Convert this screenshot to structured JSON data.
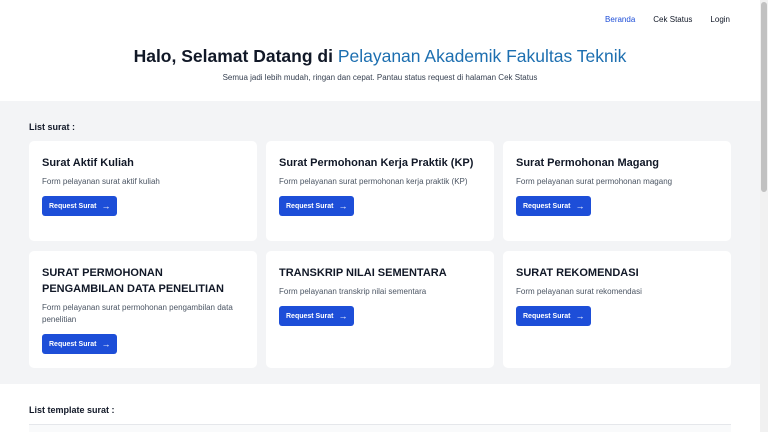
{
  "nav": {
    "items": [
      {
        "label": "Beranda",
        "active": true
      },
      {
        "label": "Cek Status",
        "active": false
      },
      {
        "label": "Login",
        "active": false
      }
    ]
  },
  "hero": {
    "title_prefix": "Halo, Selamat Datang di",
    "title_accent": "Pelayanan Akademik Fakultas Teknik",
    "subtitle": "Semua jadi lebih mudah, ringan dan cepat. Pantau status request di halaman Cek Status"
  },
  "list_surat": {
    "label": "List surat :",
    "button_label": "Request Surat",
    "cards": [
      {
        "title": "Surat Aktif Kuliah",
        "desc": "Form pelayanan surat aktif kuliah"
      },
      {
        "title": "Surat Permohonan Kerja Praktik (KP)",
        "desc": "Form pelayanan surat permohonan kerja praktik (KP)"
      },
      {
        "title": "Surat Permohonan Magang",
        "desc": "Form pelayanan surat permohonan magang"
      },
      {
        "title": "SURAT PERMOHONAN PENGAMBILAN DATA PENELITIAN",
        "desc": "Form pelayanan surat permohonan pengambilan data penelitian"
      },
      {
        "title": "TRANSKRIP NILAI SEMENTARA",
        "desc": "Form pelayanan transkrip nilai sementara"
      },
      {
        "title": "SURAT REKOMENDASI",
        "desc": "Form pelayanan surat rekomendasi"
      }
    ]
  },
  "list_template": {
    "label": "List template surat :"
  },
  "colors": {
    "accent": "#1d4ed8",
    "title_accent": "#1d6fb0",
    "background": "#f3f4f6"
  },
  "icons": {
    "button_arrow": "arrow-right-icon"
  }
}
